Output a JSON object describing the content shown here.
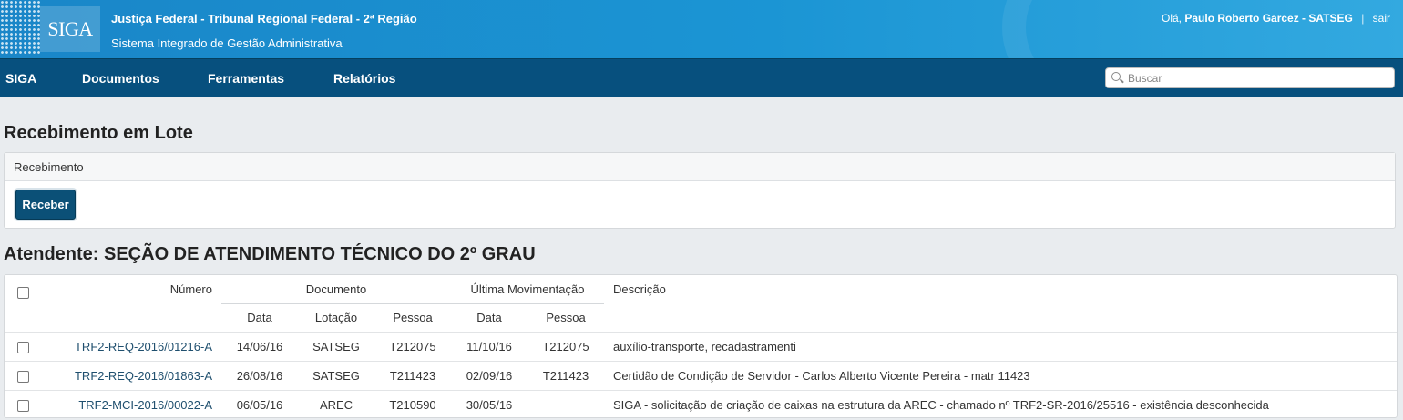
{
  "header": {
    "logo_text": "SIGA",
    "org_name": "Justiça Federal - Tribunal Regional Federal - 2ª Região",
    "system_name": "Sistema Integrado de Gestão Administrativa",
    "greeting": "Olá,",
    "user": "Paulo Roberto Garcez - SATSEG",
    "separator": "|",
    "logout": "sair"
  },
  "nav": {
    "items": [
      {
        "label": "SIGA"
      },
      {
        "label": "Documentos"
      },
      {
        "label": "Ferramentas"
      },
      {
        "label": "Relatórios"
      }
    ],
    "search_placeholder": "Buscar"
  },
  "page": {
    "title": "Recebimento em Lote",
    "panel_title": "Recebimento",
    "receive_button": "Receber",
    "attendant_title": "Atendente: SEÇÃO DE ATENDIMENTO TÉCNICO DO 2º GRAU"
  },
  "table": {
    "headers": {
      "numero": "Número",
      "documento": "Documento",
      "ultima_movimentacao": "Última Movimentação",
      "descricao": "Descrição",
      "data": "Data",
      "lotacao": "Lotação",
      "pessoa": "Pessoa",
      "data2": "Data",
      "pessoa2": "Pessoa"
    },
    "rows": [
      {
        "numero": "TRF2-REQ-2016/01216-A",
        "data": "14/06/16",
        "lotacao": "SATSEG",
        "pessoa": "T212075",
        "mov_data": "11/10/16",
        "mov_pessoa": "T212075",
        "descricao": "auxílio-transporte, recadastramenti"
      },
      {
        "numero": "TRF2-REQ-2016/01863-A",
        "data": "26/08/16",
        "lotacao": "SATSEG",
        "pessoa": "T211423",
        "mov_data": "02/09/16",
        "mov_pessoa": "T211423",
        "descricao": "Certidão de Condição de Servidor - Carlos Alberto Vicente Pereira - matr 11423"
      },
      {
        "numero": "TRF2-MCI-2016/00022-A",
        "data": "06/05/16",
        "lotacao": "AREC",
        "pessoa": "T210590",
        "mov_data": "30/05/16",
        "mov_pessoa": "",
        "descricao": "SIGA - solicitação de criação de caixas na estrutura da AREC - chamado nº TRF2-SR-2016/25516 - existência desconhecida"
      }
    ]
  },
  "colors": {
    "header_blue": "#1b95d4",
    "nav_blue": "#07507e",
    "button": "#0b5077",
    "page_bg": "#e9ecef"
  }
}
